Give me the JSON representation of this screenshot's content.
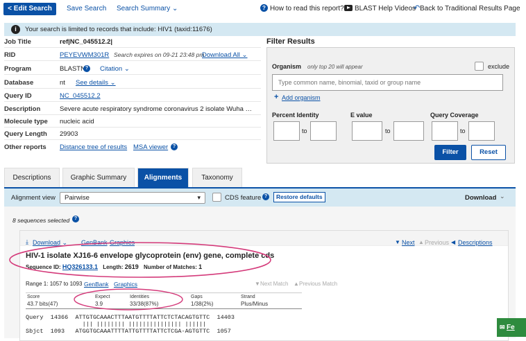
{
  "topbar": {
    "edit_search": "< Edit Search",
    "save_search": "Save Search",
    "search_summary": "Search Summary ⌄",
    "how_to_read": "How to read this report?",
    "blast_help_videos": "BLAST Help Videos",
    "back_to_traditional": "Back to Traditional Results Page"
  },
  "notice": {
    "text": "Your search is limited to records that include: HIV1 (taxid:11676)"
  },
  "job": {
    "job_title_label": "Job Title",
    "job_title_value": "ref|NC_045512.2|",
    "rid_label": "RID",
    "rid_value": "PEYEVWM301R",
    "rid_expires": "Search expires on 09-21 23:48 pm",
    "download_all": "Download All ⌄",
    "program_label": "Program",
    "program_value": "BLASTN",
    "citation": "Citation ⌄",
    "database_label": "Database",
    "database_value": "nt",
    "see_details": "See details ⌄",
    "query_id_label": "Query ID",
    "query_id_value": "NC_045512.2",
    "description_label": "Description",
    "description_value": "Severe acute respiratory syndrome coronavirus 2 isolate Wuha …",
    "molecule_label": "Molecule type",
    "molecule_value": "nucleic acid",
    "qlen_label": "Query Length",
    "qlen_value": "29903",
    "other_label": "Other reports",
    "distance_tree": "Distance tree of results",
    "msa_viewer": "MSA viewer"
  },
  "filter": {
    "title": "Filter Results",
    "organism_label": "Organism",
    "organism_note": "only top 20 will appear",
    "exclude": "exclude",
    "organism_placeholder": "Type common name, binomial, taxid or group name",
    "add_organism": "Add organism",
    "pct_identity": "Percent Identity",
    "evalue": "E value",
    "query_coverage": "Query Coverage",
    "to": "to",
    "filter_btn": "Filter",
    "reset_btn": "Reset"
  },
  "tabs": [
    "Descriptions",
    "Graphic Summary",
    "Alignments",
    "Taxonomy"
  ],
  "viewbar": {
    "alignment_view_label": "Alignment view",
    "alignment_view_value": "Pairwise",
    "cds_feature": "CDS feature",
    "restore_defaults": "Restore defaults",
    "download": "Download"
  },
  "panel": {
    "sequences_selected": "8 sequences selected"
  },
  "result": {
    "download": "Download ⌄",
    "genbank": "GenBank",
    "graphics": "Graphics",
    "next": "Next",
    "previous": "Previous",
    "descriptions": "Descriptions",
    "title": "HIV-1 isolate XJ16-6 envelope glycoprotein (env) gene, complete cds",
    "seqid_label": "Sequence ID:",
    "seqid_value": "HQ326133.1",
    "length_label": "Length:",
    "length_value": "2619",
    "matches_label": "Number of Matches:",
    "matches_value": "1",
    "range": "Range 1: 1057 to 1093",
    "range_genbank": "GenBank",
    "range_graphics": "Graphics",
    "next_match": "Next Match",
    "previous_match": "Previous Match",
    "score_label": "Score",
    "score_value": "43.7 bits(47)",
    "expect_label": "Expect",
    "expect_value": "3.9",
    "identities_label": "Identities",
    "identities_value": "33/38(87%)",
    "gaps_label": "Gaps",
    "gaps_value": "1/38(2%)",
    "strand_label": "Strand",
    "strand_value": "Plus/Minus",
    "q_label": "Query",
    "q_start": "14366",
    "q_seq": "ATTGTGCAAACTTTAATGTTTTATTCTCTACAGTGTTC",
    "q_end": "14403",
    "mid": "||| |||||||| ||||||||||||||| ||||||",
    "s_label": "Sbjct",
    "s_start": "1093",
    "s_seq": "ATGGTGCAAATTTTATTGTTTTATTCTCGA-AGTGTTC",
    "s_end": "1057"
  },
  "feedback": "Fe",
  "colors": {
    "accent": "#0a51a6",
    "highlight": "#d4e8f2",
    "annotation": "#d43a7a",
    "feedback": "#2e8b3e"
  }
}
